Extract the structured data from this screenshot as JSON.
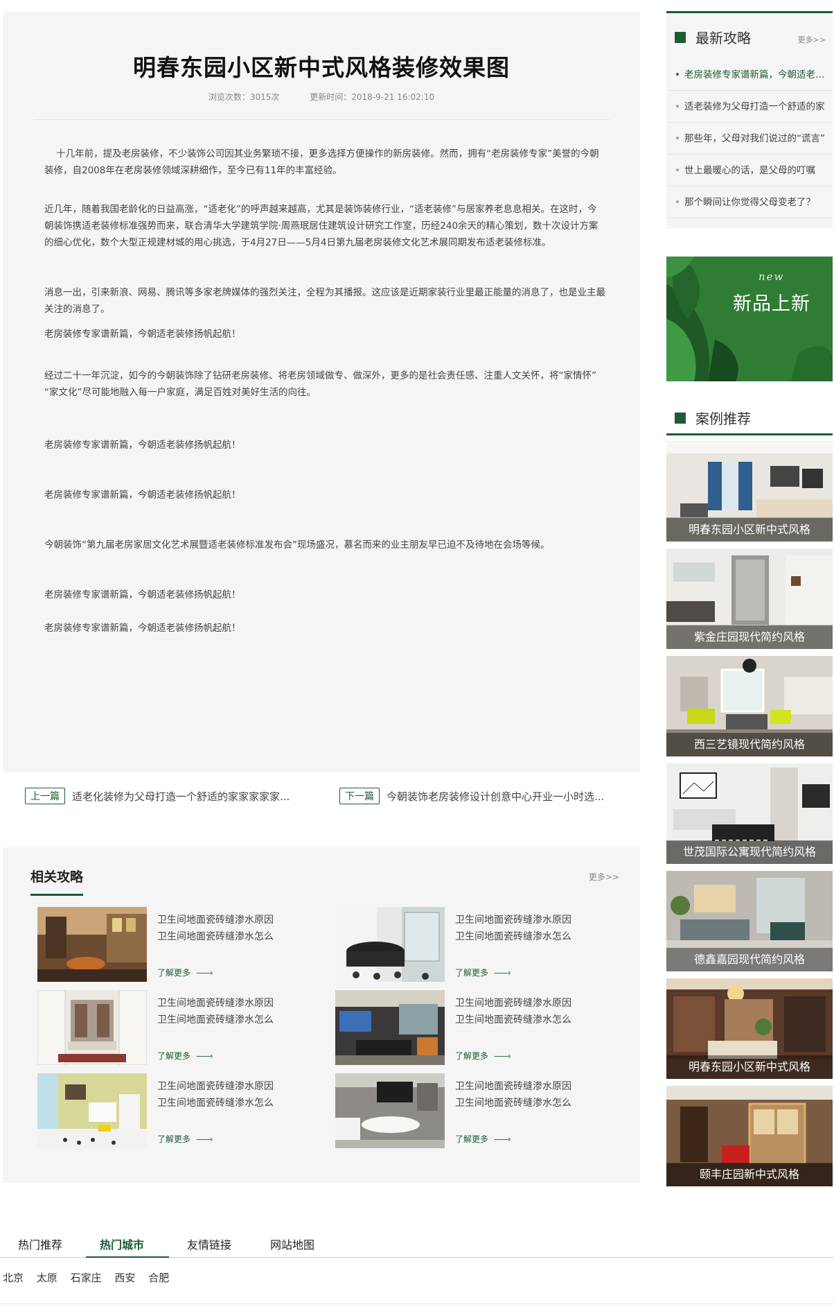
{
  "article": {
    "title": "明春东园小区新中式风格装修效果图",
    "views": "浏览次数：3015次",
    "updated": "更新时间：2018-9-21  16:02:10",
    "paragraphs": [
      "    十几年前，提及老房装修，不少装饰公司因其业务繁琐不接，更多选择方便操作的新房装修。然而，拥有“老房装修专家”美誉的今朝装修，自2008年在老房装修领域深耕细作，至今已有11年的丰富经验。",
      "近几年，随着我国老龄化的日益高涨，“适老化”的呼声越来越高，尤其是装饰装修行业，“适老装修”与居家养老息息相关。在这时，今朝装饰携适老装修标准强势而来，联合清华大学建筑学院·周燕珉居住建筑设计研究工作室，历经240余天的精心策划，数十次设计方案的细心优化，数个大型正规建材城的用心挑选，于4月27日——5月4日第九届老房装修文化艺术展同期发布适老装修标准。",
      "消息一出，引来新浪、网易、腾讯等多家老牌媒体的强烈关注，全程为其播报。这应该是近期家装行业里最正能量的消息了，也是业主最关注的消息了。",
      "老房装修专家谱新篇，今朝适老装修扬帆起航！",
      "经过二十一年沉淀，如今的今朝装饰除了钻研老房装修、将老房领域做专、做深外，更多的是社会责任感、注重人文关怀，将“家情怀” “家文化”尽可能地融入每一户家庭，满足百姓对美好生活的向往。",
      "老房装修专家谱新篇，今朝适老装修扬帆起航！",
      "老房装修专家谱新篇，今朝适老装修扬帆起航！",
      "今朝装饰“第九届老房家居文化艺术展暨适老装修标准发布会”现场盛况，慕名而来的业主朋友早已迫不及待地在会场等候。",
      "老房装修专家谱新篇，今朝适老装修扬帆起航！",
      "老房装修专家谱新篇，今朝适老装修扬帆起航！"
    ]
  },
  "pager": {
    "prev_tag": "上一篇",
    "prev_title": "适老化装修为父母打造一个舒适的家家家家家...",
    "next_tag": "下一篇",
    "next_title": "今朝装饰老房装修设计创意中心开业一小时选..."
  },
  "related": {
    "title": "相关攻略",
    "more": "更多>>",
    "items": [
      {
        "line1": "卫生间地面瓷砖缝渗水原因",
        "line2": "卫生间地面瓷砖缝渗水怎么",
        "more": "了解更多"
      },
      {
        "line1": "卫生间地面瓷砖缝渗水原因",
        "line2": "卫生间地面瓷砖缝渗水怎么",
        "more": "了解更多"
      },
      {
        "line1": "卫生间地面瓷砖缝渗水原因",
        "line2": "卫生间地面瓷砖缝渗水怎么",
        "more": "了解更多"
      },
      {
        "line1": "卫生间地面瓷砖缝渗水原因",
        "line2": "卫生间地面瓷砖缝渗水怎么",
        "more": "了解更多"
      },
      {
        "line1": "卫生间地面瓷砖缝渗水原因",
        "line2": "卫生间地面瓷砖缝渗水怎么",
        "more": "了解更多"
      },
      {
        "line1": "卫生间地面瓷砖缝渗水原因",
        "line2": "卫生间地面瓷砖缝渗水怎么",
        "more": "了解更多"
      }
    ]
  },
  "sidebar": {
    "news_title": "最新攻略",
    "news_more": "更多>>",
    "news": [
      "老房装修专家谱新篇，今朝适老装修扬帆起航！",
      "适老装修为父母打造一个舒适的家",
      "那些年，父母对我们说过的“谎言”",
      "世上最暖心的话，是父母的叮嘱",
      "那个瞬间让你觉得父母变老了？"
    ],
    "banner_script": "new",
    "banner_text": "新品上新",
    "cases_title": "案例推荐",
    "cases": [
      "明春东园小区新中式风格",
      "紫金庄园现代简约风格",
      "西三艺镜现代简约风格",
      "世茂国际公寓现代简约风格",
      "德鑫嘉园现代简约风格",
      "明春东园小区新中式风格",
      "颐丰庄园新中式风格"
    ]
  },
  "footer": {
    "tabs": [
      "热门推荐",
      "热门城市",
      "友情链接",
      "网站地图"
    ],
    "active_tab": "热门城市",
    "cities": [
      "北京",
      "太原",
      "石家庄",
      "西安",
      "合肥"
    ]
  },
  "colors": {
    "accent": "#1d5c33",
    "panel": "#f5f5f5"
  }
}
